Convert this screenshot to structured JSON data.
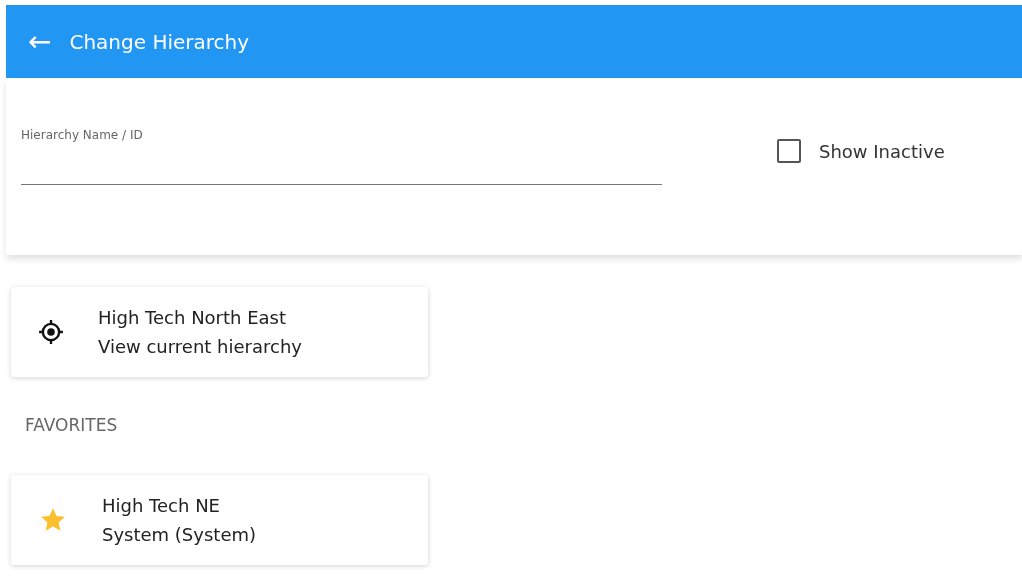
{
  "header": {
    "back_icon": "←",
    "title": "Change Hierarchy"
  },
  "search": {
    "label": "Hierarchy Name / ID"
  },
  "show_inactive": {
    "label": "Show Inactive",
    "checked": false
  },
  "current": {
    "name": "High Tech North East",
    "subtitle": "View current hierarchy"
  },
  "favorites": {
    "heading": "FAVORITES",
    "items": [
      {
        "name": "High Tech NE",
        "subtitle": "System (System)"
      }
    ]
  }
}
